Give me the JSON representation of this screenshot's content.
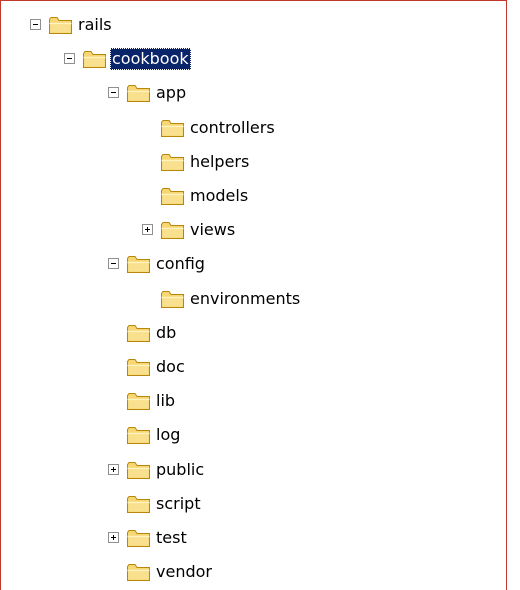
{
  "tree": {
    "nodes": [
      {
        "label": "rails",
        "toggle": "minus",
        "selected": false,
        "level": 0
      },
      {
        "label": "cookbook",
        "toggle": "minus",
        "selected": true,
        "level": 1
      },
      {
        "label": "app",
        "toggle": "minus",
        "selected": false,
        "level": 2
      },
      {
        "label": "controllers",
        "toggle": "none",
        "selected": false,
        "level": 3
      },
      {
        "label": "helpers",
        "toggle": "none",
        "selected": false,
        "level": 3
      },
      {
        "label": "models",
        "toggle": "none",
        "selected": false,
        "level": 3
      },
      {
        "label": "views",
        "toggle": "plus",
        "selected": false,
        "level": 3
      },
      {
        "label": "config",
        "toggle": "minus",
        "selected": false,
        "level": 2
      },
      {
        "label": "environments",
        "toggle": "none",
        "selected": false,
        "level": 3
      },
      {
        "label": "db",
        "toggle": "none",
        "selected": false,
        "level": 2
      },
      {
        "label": "doc",
        "toggle": "none",
        "selected": false,
        "level": 2
      },
      {
        "label": "lib",
        "toggle": "none",
        "selected": false,
        "level": 2
      },
      {
        "label": "log",
        "toggle": "none",
        "selected": false,
        "level": 2
      },
      {
        "label": "public",
        "toggle": "plus",
        "selected": false,
        "level": 2
      },
      {
        "label": "script",
        "toggle": "none",
        "selected": false,
        "level": 2
      },
      {
        "label": "test",
        "toggle": "plus",
        "selected": false,
        "level": 2
      },
      {
        "label": "vendor",
        "toggle": "none",
        "selected": false,
        "level": 2
      }
    ]
  },
  "colors": {
    "folder_fill": "#f7d774",
    "folder_stroke": "#b8860b",
    "selection": "#0a246a",
    "frame_border": "#c0392b"
  },
  "icons": {
    "folder": "folder-icon",
    "expand": "expand-plus-icon",
    "collapse": "collapse-minus-icon"
  }
}
